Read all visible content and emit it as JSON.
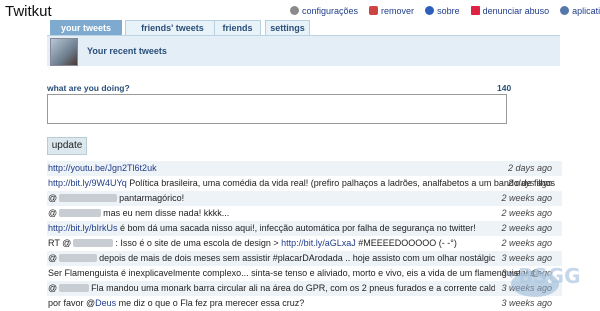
{
  "app": {
    "title": "Twitkut"
  },
  "top_links": [
    {
      "label": "configurações",
      "icon": "gear-icon"
    },
    {
      "label": "remover",
      "icon": "remove-icon"
    },
    {
      "label": "sobre",
      "icon": "info-icon"
    },
    {
      "label": "denunciar abuso",
      "icon": "flag-icon"
    },
    {
      "label": "aplicativos",
      "icon": "apps-icon"
    }
  ],
  "tabs": [
    {
      "label": "your tweets",
      "active": true
    },
    {
      "label": "friends' tweets",
      "active": false
    },
    {
      "label": "friends",
      "active": false
    },
    {
      "label": "settings",
      "active": false
    }
  ],
  "header": {
    "title": "Your recent tweets"
  },
  "compose": {
    "prompt": "what are you doing?",
    "counter": "140",
    "button": "update",
    "value": ""
  },
  "feed": [
    {
      "parts": [
        {
          "link": "http://youtu.be/Jgn2Tl6t2uk"
        }
      ],
      "time": "2 days ago"
    },
    {
      "parts": [
        {
          "link": "http://bit.ly/9W4UYq"
        },
        {
          "text": " Política brasileira, uma comédia da vida real! (prefiro palhaços a ladrões, analfabetos a um bando de filhos"
        }
      ],
      "time": "2 days ago"
    },
    {
      "parts": [
        {
          "text": "@"
        },
        {
          "blur": true
        },
        {
          "text": "pantarmagórico!"
        }
      ],
      "time": "2 weeks ago"
    },
    {
      "parts": [
        {
          "text": "@"
        },
        {
          "blur": true
        },
        {
          "text": "mas eu nem disse nada! kkkk..."
        }
      ],
      "time": "2 weeks ago"
    },
    {
      "parts": [
        {
          "link": "http://bit.ly/bIrkUs"
        },
        {
          "text": " é bom dá uma sacada nisso aqui!, infecção automática por falha de segurança no twitter!"
        }
      ],
      "time": "2 weeks ago"
    },
    {
      "parts": [
        {
          "text": "RT @"
        },
        {
          "blur": true
        },
        {
          "text": ": Isso é o site de uma escola de design > "
        },
        {
          "link": "http://bit.ly/aGLxaJ"
        },
        {
          "text": " #MEEEEDOOOOO (- -°)"
        }
      ],
      "time": "2 weeks ago"
    },
    {
      "parts": [
        {
          "text": "@"
        },
        {
          "blur": true
        },
        {
          "text": "depois de mais de dois meses sem assistir #placarDArodada .. hoje assisto com um olhar nostálgico!"
        }
      ],
      "time": "3 weeks ago"
    },
    {
      "parts": [
        {
          "text": "Ser Flamenguista é inexplicavelmente complexo... sinta-se tenso e aliviado, morto e vivo, eis a vida de um flamenguista! @"
        }
      ],
      "time": "3 weeks ago"
    },
    {
      "parts": [
        {
          "text": "@"
        },
        {
          "blur": true
        },
        {
          "text": "Fla mandou uma monark barra circular ali na área do GPR, com os 2 pneus furados e a corrente calda"
        }
      ],
      "time": "3 weeks ago"
    },
    {
      "parts": [
        {
          "text": "por favor @"
        },
        {
          "link": "Deus"
        },
        {
          "text": " me diz o que o Fla fez pra merecer essa cruz?"
        }
      ],
      "time": "3 weeks ago"
    }
  ],
  "watermark": {
    "text": "BSGG"
  }
}
